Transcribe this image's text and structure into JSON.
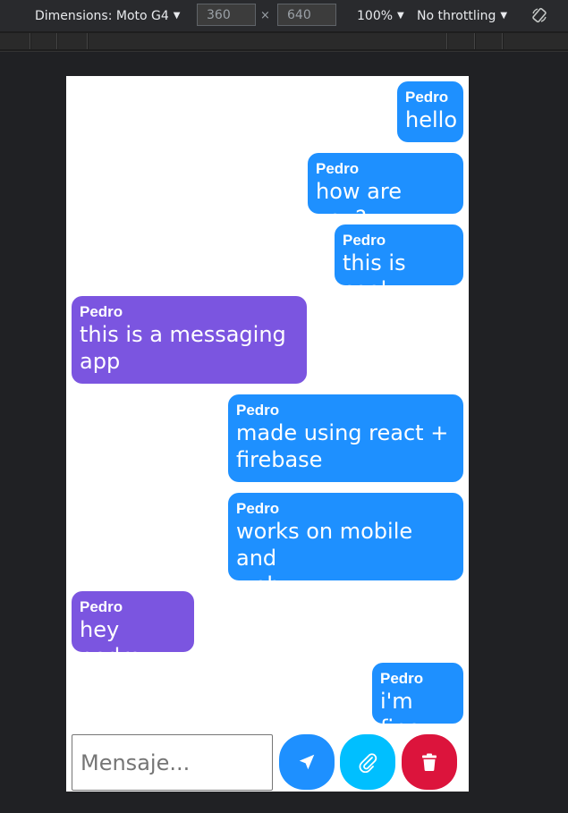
{
  "devtools": {
    "device_label": "Dimensions: Moto G4",
    "width_value": "360",
    "times_symbol": "×",
    "height_value": "640",
    "zoom_label": "100%",
    "throttle_label": "No throttling",
    "dropdown_glyph": "▼"
  },
  "colors": {
    "sent_bubble": "#1e90ff",
    "received_bubble": "#7b55e0",
    "send_button": "#1e90ff",
    "attach_button": "#00bfff",
    "delete_button": "#dc143c"
  },
  "messages": [
    {
      "sender": "Pedro",
      "text": "hello",
      "side": "sent"
    },
    {
      "sender": "Pedro",
      "text": "how are you?",
      "side": "sent"
    },
    {
      "sender": "Pedro",
      "text": "this is cool",
      "side": "sent"
    },
    {
      "sender": "Pedro",
      "text": "this is a messaging\napp",
      "side": "received"
    },
    {
      "sender": "Pedro",
      "text": "made using react +\nfirebase",
      "side": "sent"
    },
    {
      "sender": "Pedro",
      "text": "works on mobile and\nweb",
      "side": "sent"
    },
    {
      "sender": "Pedro",
      "text": "hey pedro",
      "side": "received"
    },
    {
      "sender": "Pedro",
      "text": "i'm fine",
      "side": "sent"
    }
  ],
  "composer": {
    "placeholder": "Mensaje...",
    "send_icon": "send-icon",
    "attach_icon": "paperclip-icon",
    "delete_icon": "trash-icon"
  }
}
